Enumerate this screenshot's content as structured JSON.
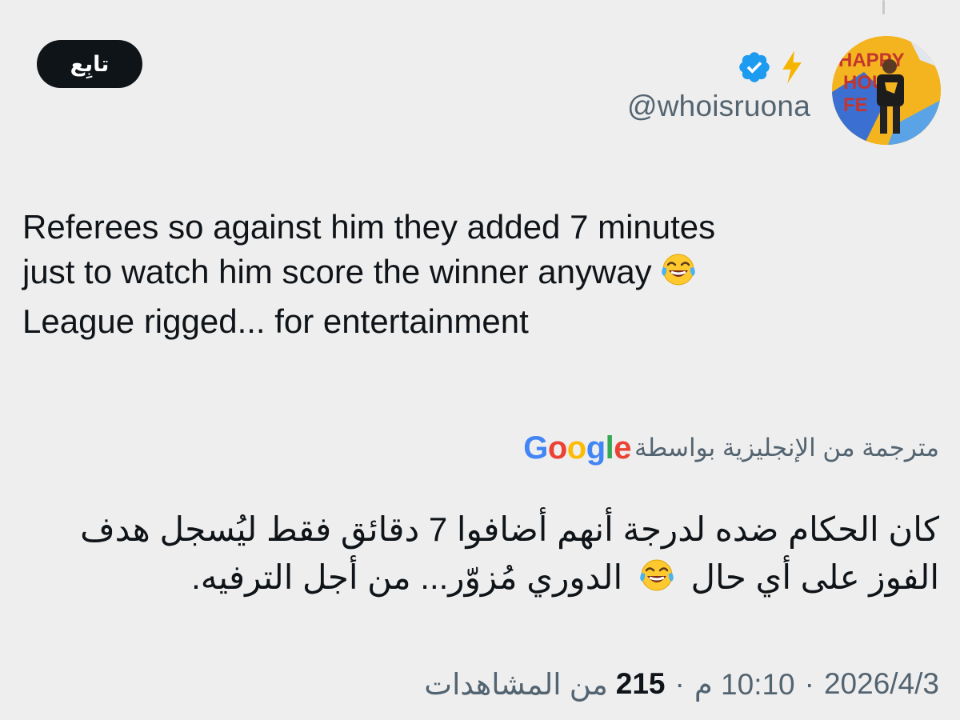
{
  "tweet": {
    "handle": "@whoisruona",
    "follow_label": "تابِع",
    "avatar_text": [
      "HAPPY",
      "HOUR",
      "FE"
    ],
    "text_lines": [
      "Referees so against him they added 7 minutes",
      "just to watch him score the winner anyway",
      "League rigged... for entertainment"
    ],
    "translation": {
      "label": "مترجمة من الإنجليزية بواسطة",
      "provider": "Google",
      "lines": [
        "كان الحكام ضده لدرجة أنهم أضافوا 7 دقائق فقط ليُسجل هدف",
        "الفوز على أي حال",
        "الدوري مُزوّر... من أجل الترفيه."
      ]
    },
    "meta": {
      "date": "2026/4/3",
      "separator": "·",
      "time": "10:10 م",
      "views_count": "215",
      "views_label": "من المشاهدات"
    }
  },
  "icons": {
    "verified": "verified-badge-icon",
    "bolt": "lightning-bolt-icon",
    "emoji": "face-with-tears-of-joy-icon"
  },
  "colors": {
    "background": "#efeeee",
    "text": "#0f1419",
    "secondary_text": "#536471",
    "verified_blue": "#1d9bf0",
    "follow_button": "#0f1419"
  }
}
